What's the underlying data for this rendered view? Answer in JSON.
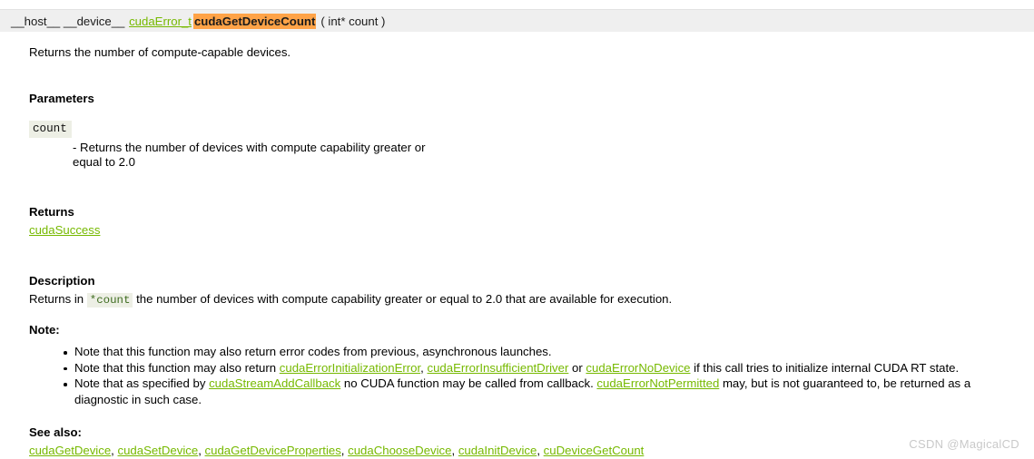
{
  "signature": {
    "qualifiers": "__host__ __device__",
    "return_type_link": "cudaError_t",
    "function_name": "cudaGetDeviceCount",
    "arguments": "( int* count  )"
  },
  "intro": "Returns the number of compute-capable devices.",
  "sections": {
    "parameters": {
      "heading": "Parameters",
      "param_name": "count",
      "param_desc": "- Returns the number of devices with compute capability greater or equal to 2.0"
    },
    "returns": {
      "heading": "Returns",
      "value_link": "cudaSuccess"
    },
    "description": {
      "heading": "Description",
      "text_before_code": "Returns in ",
      "inline_code": "*count",
      "text_after_code": " the number of devices with compute capability greater or equal to 2.0 that are available for execution.",
      "note_heading": "Note:",
      "notes": [
        {
          "segments": [
            {
              "type": "text",
              "value": "Note that this function may also return error codes from previous, asynchronous launches."
            }
          ]
        },
        {
          "segments": [
            {
              "type": "text",
              "value": "Note that this function may also return "
            },
            {
              "type": "link",
              "value": "cudaErrorInitializationError"
            },
            {
              "type": "text",
              "value": ", "
            },
            {
              "type": "link",
              "value": "cudaErrorInsufficientDriver"
            },
            {
              "type": "text",
              "value": " or "
            },
            {
              "type": "link",
              "value": "cudaErrorNoDevice"
            },
            {
              "type": "text",
              "value": " if this call tries to initialize internal CUDA RT state."
            }
          ]
        },
        {
          "segments": [
            {
              "type": "text",
              "value": "Note that as specified by "
            },
            {
              "type": "link",
              "value": "cudaStreamAddCallback"
            },
            {
              "type": "text",
              "value": " no CUDA function may be called from callback. "
            },
            {
              "type": "link",
              "value": "cudaErrorNotPermitted"
            },
            {
              "type": "text",
              "value": " may, but is not guaranteed to, be returned as a diagnostic in such case."
            }
          ]
        }
      ]
    },
    "see_also": {
      "heading": "See also:",
      "links": [
        "cudaGetDevice",
        "cudaSetDevice",
        "cudaGetDeviceProperties",
        "cudaChooseDevice",
        "cudaInitDevice",
        "cuDeviceGetCount"
      ],
      "separator": ", "
    }
  },
  "watermark": "CSDN @MagicalCD",
  "colors": {
    "link": "#76b900",
    "highlight": "#ffa347",
    "band_bg": "#efefef",
    "code_bg": "#edefe5",
    "inline_code_text": "#3d6b1f",
    "watermark": "#c9c9c9"
  }
}
